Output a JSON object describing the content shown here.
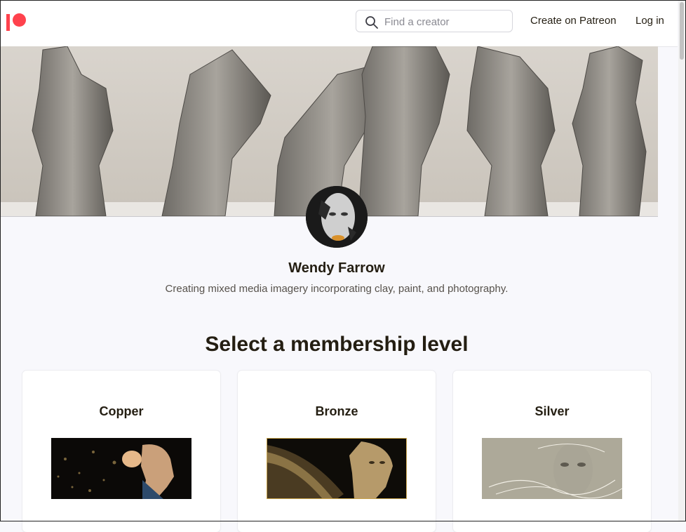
{
  "header": {
    "logo_name": "patreon-logo",
    "search": {
      "placeholder": "Find a creator",
      "value": ""
    },
    "create_link": "Create on Patreon",
    "login_link": "Log in"
  },
  "creator": {
    "name": "Wendy Farrow",
    "tagline": "Creating mixed media imagery incorporating clay, paint, and photography."
  },
  "membership": {
    "title": "Select a membership level",
    "tiers": [
      {
        "name": "Copper"
      },
      {
        "name": "Bronze"
      },
      {
        "name": "Silver"
      }
    ]
  },
  "colors": {
    "brand": "#ff424d",
    "page_bg": "#f8f8fc",
    "text": "#241e12"
  }
}
